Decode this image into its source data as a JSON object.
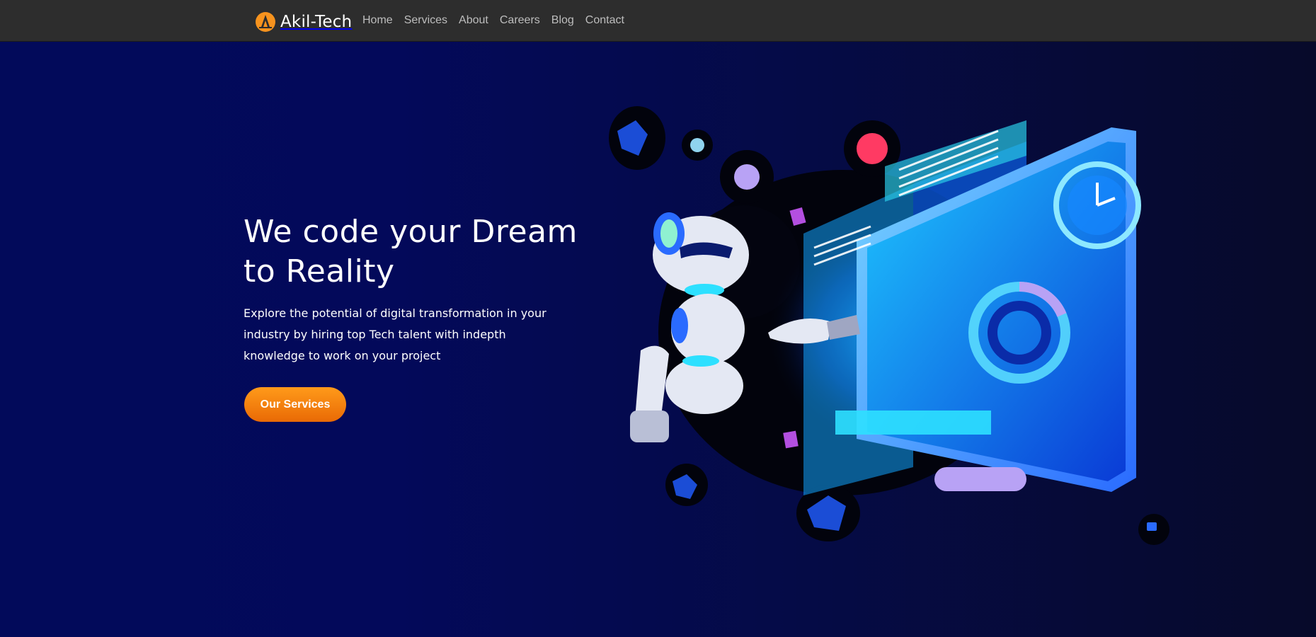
{
  "nav": {
    "brand": "Akil-Tech",
    "links": [
      "Home",
      "Services",
      "About",
      "Careers",
      "Blog",
      "Contact"
    ]
  },
  "hero": {
    "title": "We code your Dream to Reality",
    "description": "Explore the potential of digital transformation in your industry by hiring top Tech talent with indepth knowledge to work on your project",
    "cta_label": "Our Services"
  },
  "colors": {
    "navbar": "#2d2d2d",
    "hero_bg": "#020b56",
    "cta": "#f57c0b",
    "accent_cyan": "#2de0ff"
  },
  "icons": {
    "logo": "akil-tech-logo-icon",
    "illustration": "robot-touching-screen-illustration"
  }
}
